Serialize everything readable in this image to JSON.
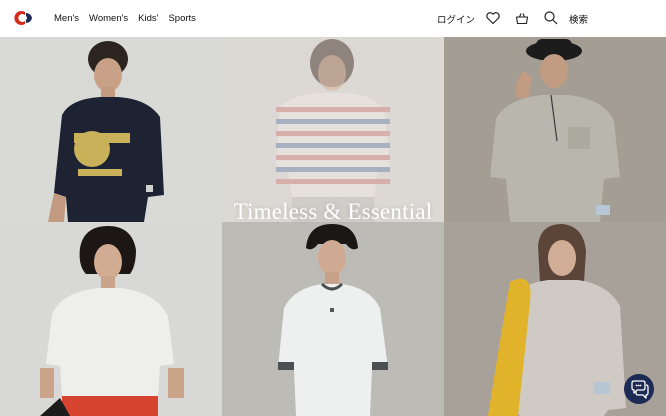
{
  "nav": {
    "items": [
      {
        "label": "Men's"
      },
      {
        "label": "Women's"
      },
      {
        "label": "Kids'"
      },
      {
        "label": "Sports"
      }
    ]
  },
  "header": {
    "login_label": "ログイン",
    "search_label": "検索",
    "icons": [
      "champion-logo-icon",
      "heart-icon",
      "cart-icon",
      "search-icon"
    ]
  },
  "hero": {
    "tagline": "Timeless & Essential",
    "tiles": [
      {
        "name": "model-navy-graphic-tee"
      },
      {
        "name": "model-striped-tee"
      },
      {
        "name": "model-grey-pocket-tee"
      },
      {
        "name": "model-white-tee-shorts"
      },
      {
        "name": "model-ringer-tee"
      },
      {
        "name": "model-grey-sweatshirt"
      }
    ]
  },
  "chat": {
    "icon": "chat-icon"
  },
  "colors": {
    "brand_red": "#d52b1e",
    "brand_navy": "#1b2b56",
    "text": "#111111"
  }
}
